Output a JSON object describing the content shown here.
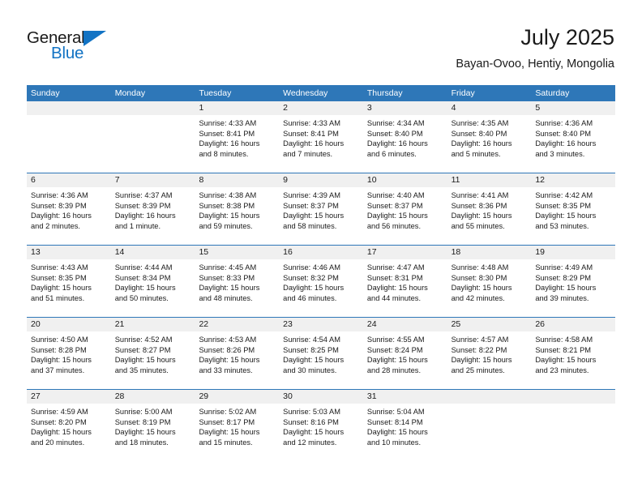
{
  "brand": {
    "name_part1": "General",
    "name_part2": "Blue",
    "accent_color": "#1273c4"
  },
  "header": {
    "month_title": "July 2025",
    "location": "Bayan-Ovoo, Hentiy, Mongolia"
  },
  "theme": {
    "header_blue": "#2e77b8",
    "day_band_gray": "#f0f0f0"
  },
  "calendar": {
    "weekday_headers": [
      "Sunday",
      "Monday",
      "Tuesday",
      "Wednesday",
      "Thursday",
      "Friday",
      "Saturday"
    ],
    "weeks": [
      [
        {
          "day": "",
          "sunrise": "",
          "sunset": "",
          "daylight1": "",
          "daylight2": ""
        },
        {
          "day": "",
          "sunrise": "",
          "sunset": "",
          "daylight1": "",
          "daylight2": ""
        },
        {
          "day": "1",
          "sunrise": "Sunrise: 4:33 AM",
          "sunset": "Sunset: 8:41 PM",
          "daylight1": "Daylight: 16 hours",
          "daylight2": "and 8 minutes."
        },
        {
          "day": "2",
          "sunrise": "Sunrise: 4:33 AM",
          "sunset": "Sunset: 8:41 PM",
          "daylight1": "Daylight: 16 hours",
          "daylight2": "and 7 minutes."
        },
        {
          "day": "3",
          "sunrise": "Sunrise: 4:34 AM",
          "sunset": "Sunset: 8:40 PM",
          "daylight1": "Daylight: 16 hours",
          "daylight2": "and 6 minutes."
        },
        {
          "day": "4",
          "sunrise": "Sunrise: 4:35 AM",
          "sunset": "Sunset: 8:40 PM",
          "daylight1": "Daylight: 16 hours",
          "daylight2": "and 5 minutes."
        },
        {
          "day": "5",
          "sunrise": "Sunrise: 4:36 AM",
          "sunset": "Sunset: 8:40 PM",
          "daylight1": "Daylight: 16 hours",
          "daylight2": "and 3 minutes."
        }
      ],
      [
        {
          "day": "6",
          "sunrise": "Sunrise: 4:36 AM",
          "sunset": "Sunset: 8:39 PM",
          "daylight1": "Daylight: 16 hours",
          "daylight2": "and 2 minutes."
        },
        {
          "day": "7",
          "sunrise": "Sunrise: 4:37 AM",
          "sunset": "Sunset: 8:39 PM",
          "daylight1": "Daylight: 16 hours",
          "daylight2": "and 1 minute."
        },
        {
          "day": "8",
          "sunrise": "Sunrise: 4:38 AM",
          "sunset": "Sunset: 8:38 PM",
          "daylight1": "Daylight: 15 hours",
          "daylight2": "and 59 minutes."
        },
        {
          "day": "9",
          "sunrise": "Sunrise: 4:39 AM",
          "sunset": "Sunset: 8:37 PM",
          "daylight1": "Daylight: 15 hours",
          "daylight2": "and 58 minutes."
        },
        {
          "day": "10",
          "sunrise": "Sunrise: 4:40 AM",
          "sunset": "Sunset: 8:37 PM",
          "daylight1": "Daylight: 15 hours",
          "daylight2": "and 56 minutes."
        },
        {
          "day": "11",
          "sunrise": "Sunrise: 4:41 AM",
          "sunset": "Sunset: 8:36 PM",
          "daylight1": "Daylight: 15 hours",
          "daylight2": "and 55 minutes."
        },
        {
          "day": "12",
          "sunrise": "Sunrise: 4:42 AM",
          "sunset": "Sunset: 8:35 PM",
          "daylight1": "Daylight: 15 hours",
          "daylight2": "and 53 minutes."
        }
      ],
      [
        {
          "day": "13",
          "sunrise": "Sunrise: 4:43 AM",
          "sunset": "Sunset: 8:35 PM",
          "daylight1": "Daylight: 15 hours",
          "daylight2": "and 51 minutes."
        },
        {
          "day": "14",
          "sunrise": "Sunrise: 4:44 AM",
          "sunset": "Sunset: 8:34 PM",
          "daylight1": "Daylight: 15 hours",
          "daylight2": "and 50 minutes."
        },
        {
          "day": "15",
          "sunrise": "Sunrise: 4:45 AM",
          "sunset": "Sunset: 8:33 PM",
          "daylight1": "Daylight: 15 hours",
          "daylight2": "and 48 minutes."
        },
        {
          "day": "16",
          "sunrise": "Sunrise: 4:46 AM",
          "sunset": "Sunset: 8:32 PM",
          "daylight1": "Daylight: 15 hours",
          "daylight2": "and 46 minutes."
        },
        {
          "day": "17",
          "sunrise": "Sunrise: 4:47 AM",
          "sunset": "Sunset: 8:31 PM",
          "daylight1": "Daylight: 15 hours",
          "daylight2": "and 44 minutes."
        },
        {
          "day": "18",
          "sunrise": "Sunrise: 4:48 AM",
          "sunset": "Sunset: 8:30 PM",
          "daylight1": "Daylight: 15 hours",
          "daylight2": "and 42 minutes."
        },
        {
          "day": "19",
          "sunrise": "Sunrise: 4:49 AM",
          "sunset": "Sunset: 8:29 PM",
          "daylight1": "Daylight: 15 hours",
          "daylight2": "and 39 minutes."
        }
      ],
      [
        {
          "day": "20",
          "sunrise": "Sunrise: 4:50 AM",
          "sunset": "Sunset: 8:28 PM",
          "daylight1": "Daylight: 15 hours",
          "daylight2": "and 37 minutes."
        },
        {
          "day": "21",
          "sunrise": "Sunrise: 4:52 AM",
          "sunset": "Sunset: 8:27 PM",
          "daylight1": "Daylight: 15 hours",
          "daylight2": "and 35 minutes."
        },
        {
          "day": "22",
          "sunrise": "Sunrise: 4:53 AM",
          "sunset": "Sunset: 8:26 PM",
          "daylight1": "Daylight: 15 hours",
          "daylight2": "and 33 minutes."
        },
        {
          "day": "23",
          "sunrise": "Sunrise: 4:54 AM",
          "sunset": "Sunset: 8:25 PM",
          "daylight1": "Daylight: 15 hours",
          "daylight2": "and 30 minutes."
        },
        {
          "day": "24",
          "sunrise": "Sunrise: 4:55 AM",
          "sunset": "Sunset: 8:24 PM",
          "daylight1": "Daylight: 15 hours",
          "daylight2": "and 28 minutes."
        },
        {
          "day": "25",
          "sunrise": "Sunrise: 4:57 AM",
          "sunset": "Sunset: 8:22 PM",
          "daylight1": "Daylight: 15 hours",
          "daylight2": "and 25 minutes."
        },
        {
          "day": "26",
          "sunrise": "Sunrise: 4:58 AM",
          "sunset": "Sunset: 8:21 PM",
          "daylight1": "Daylight: 15 hours",
          "daylight2": "and 23 minutes."
        }
      ],
      [
        {
          "day": "27",
          "sunrise": "Sunrise: 4:59 AM",
          "sunset": "Sunset: 8:20 PM",
          "daylight1": "Daylight: 15 hours",
          "daylight2": "and 20 minutes."
        },
        {
          "day": "28",
          "sunrise": "Sunrise: 5:00 AM",
          "sunset": "Sunset: 8:19 PM",
          "daylight1": "Daylight: 15 hours",
          "daylight2": "and 18 minutes."
        },
        {
          "day": "29",
          "sunrise": "Sunrise: 5:02 AM",
          "sunset": "Sunset: 8:17 PM",
          "daylight1": "Daylight: 15 hours",
          "daylight2": "and 15 minutes."
        },
        {
          "day": "30",
          "sunrise": "Sunrise: 5:03 AM",
          "sunset": "Sunset: 8:16 PM",
          "daylight1": "Daylight: 15 hours",
          "daylight2": "and 12 minutes."
        },
        {
          "day": "31",
          "sunrise": "Sunrise: 5:04 AM",
          "sunset": "Sunset: 8:14 PM",
          "daylight1": "Daylight: 15 hours",
          "daylight2": "and 10 minutes."
        },
        {
          "day": "",
          "sunrise": "",
          "sunset": "",
          "daylight1": "",
          "daylight2": ""
        },
        {
          "day": "",
          "sunrise": "",
          "sunset": "",
          "daylight1": "",
          "daylight2": ""
        }
      ]
    ]
  }
}
